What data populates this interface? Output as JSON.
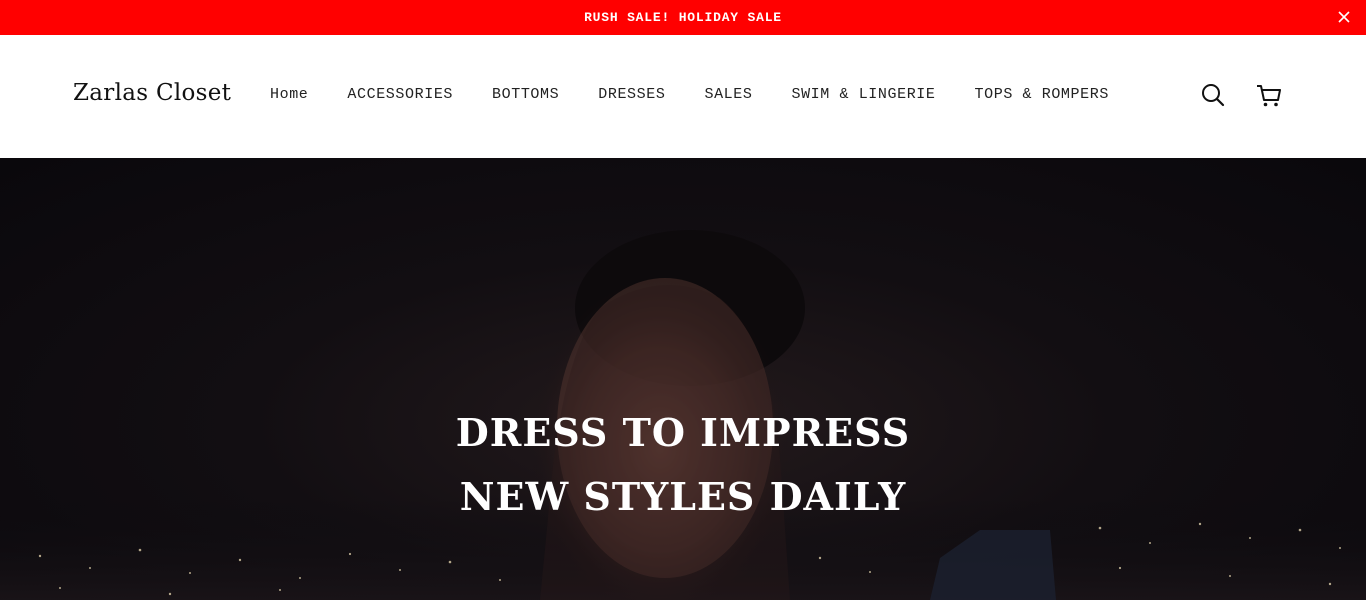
{
  "announcement": {
    "text": "RUSH SALE! HOLIDAY SALE",
    "background": "#ff0000",
    "close_icon": "close-icon"
  },
  "header": {
    "logo": "Zarlas Closet",
    "nav": [
      {
        "label": "Home"
      },
      {
        "label": "ACCESSORIES"
      },
      {
        "label": "BOTTOMS"
      },
      {
        "label": "DRESSES"
      },
      {
        "label": "SALES"
      },
      {
        "label": "SWIM & LINGERIE"
      },
      {
        "label": "TOPS & ROMPERS"
      }
    ],
    "icons": [
      "search-icon",
      "cart-icon"
    ]
  },
  "hero": {
    "line_1": "DRESS TO IMPRESS",
    "line_2": "NEW STYLES DAILY",
    "text_color": "#ffffff"
  }
}
